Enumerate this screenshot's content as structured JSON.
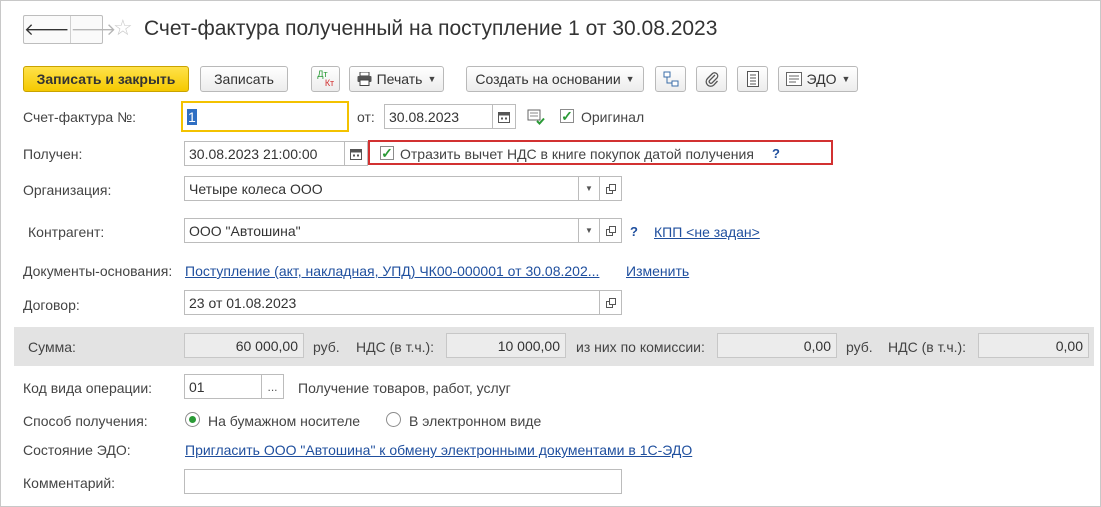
{
  "header": {
    "title": "Счет-фактура полученный на поступление 1 от 30.08.2023",
    "back_icon": "arrow-left-icon",
    "forward_icon": "arrow-right-icon",
    "favorite_icon": "star-icon"
  },
  "toolbar": {
    "save_close_label": "Записать и закрыть",
    "save_label": "Записать",
    "dtkt_label_top": "Дт",
    "dtkt_label_bottom": "Кт",
    "print_label": "Печать",
    "create_based_label": "Создать на основании",
    "edo_label": "ЭДО",
    "colors": {
      "primary": "#f5c900",
      "dtkt_top": "#2a9a36",
      "dtkt_bottom": "#d23131"
    }
  },
  "form": {
    "invoice_no_label": "Счет-фактура №:",
    "invoice_no_value": "1",
    "from_label": "от:",
    "invoice_date": "30.08.2023",
    "original_label": "Оригинал",
    "original_checked": true,
    "received_label": "Получен:",
    "received_value": "30.08.2023 21:00:00",
    "vat_deduct_label": "Отразить вычет НДС в книге покупок датой получения",
    "vat_deduct_checked": true,
    "help_mark": "?",
    "organization_label": "Организация:",
    "organization_value": "Четыре колеса ООО",
    "counterparty_label": "Контрагент:",
    "counterparty_value": "ООО \"Автошина\"",
    "kpp_link": "КПП <не задан>",
    "base_docs_label": "Документы-основания:",
    "base_docs_link": "Поступление (акт, накладная, УПД) ЧК00-000001 от 30.08.202...",
    "change_link": "Изменить",
    "contract_label": "Договор:",
    "contract_value": "23 от 01.08.2023"
  },
  "sums": {
    "amount_label": "Сумма:",
    "amount_value": "60 000,00",
    "currency_1": "руб.",
    "vat_label_1": "НДС (в т.ч.):",
    "vat_value_1": "10 000,00",
    "commission_label": "из них по комиссии:",
    "commission_value": "0,00",
    "currency_2": "руб.",
    "vat_label_2": "НДС (в т.ч.):",
    "vat_value_2": "0,00"
  },
  "operation": {
    "code_label": "Код вида операции:",
    "code_value": "01",
    "code_description": "Получение товаров, работ, услуг",
    "method_label": "Способ получения:",
    "method_paper": "На бумажном носителе",
    "method_electronic": "В электронном виде",
    "method_selected": "paper",
    "edo_state_label": "Состояние ЭДО:",
    "edo_invite_link": "Пригласить ООО \"Автошина\" к обмену электронными документами в 1С-ЭДО",
    "comment_label": "Комментарий:",
    "comment_value": ""
  }
}
